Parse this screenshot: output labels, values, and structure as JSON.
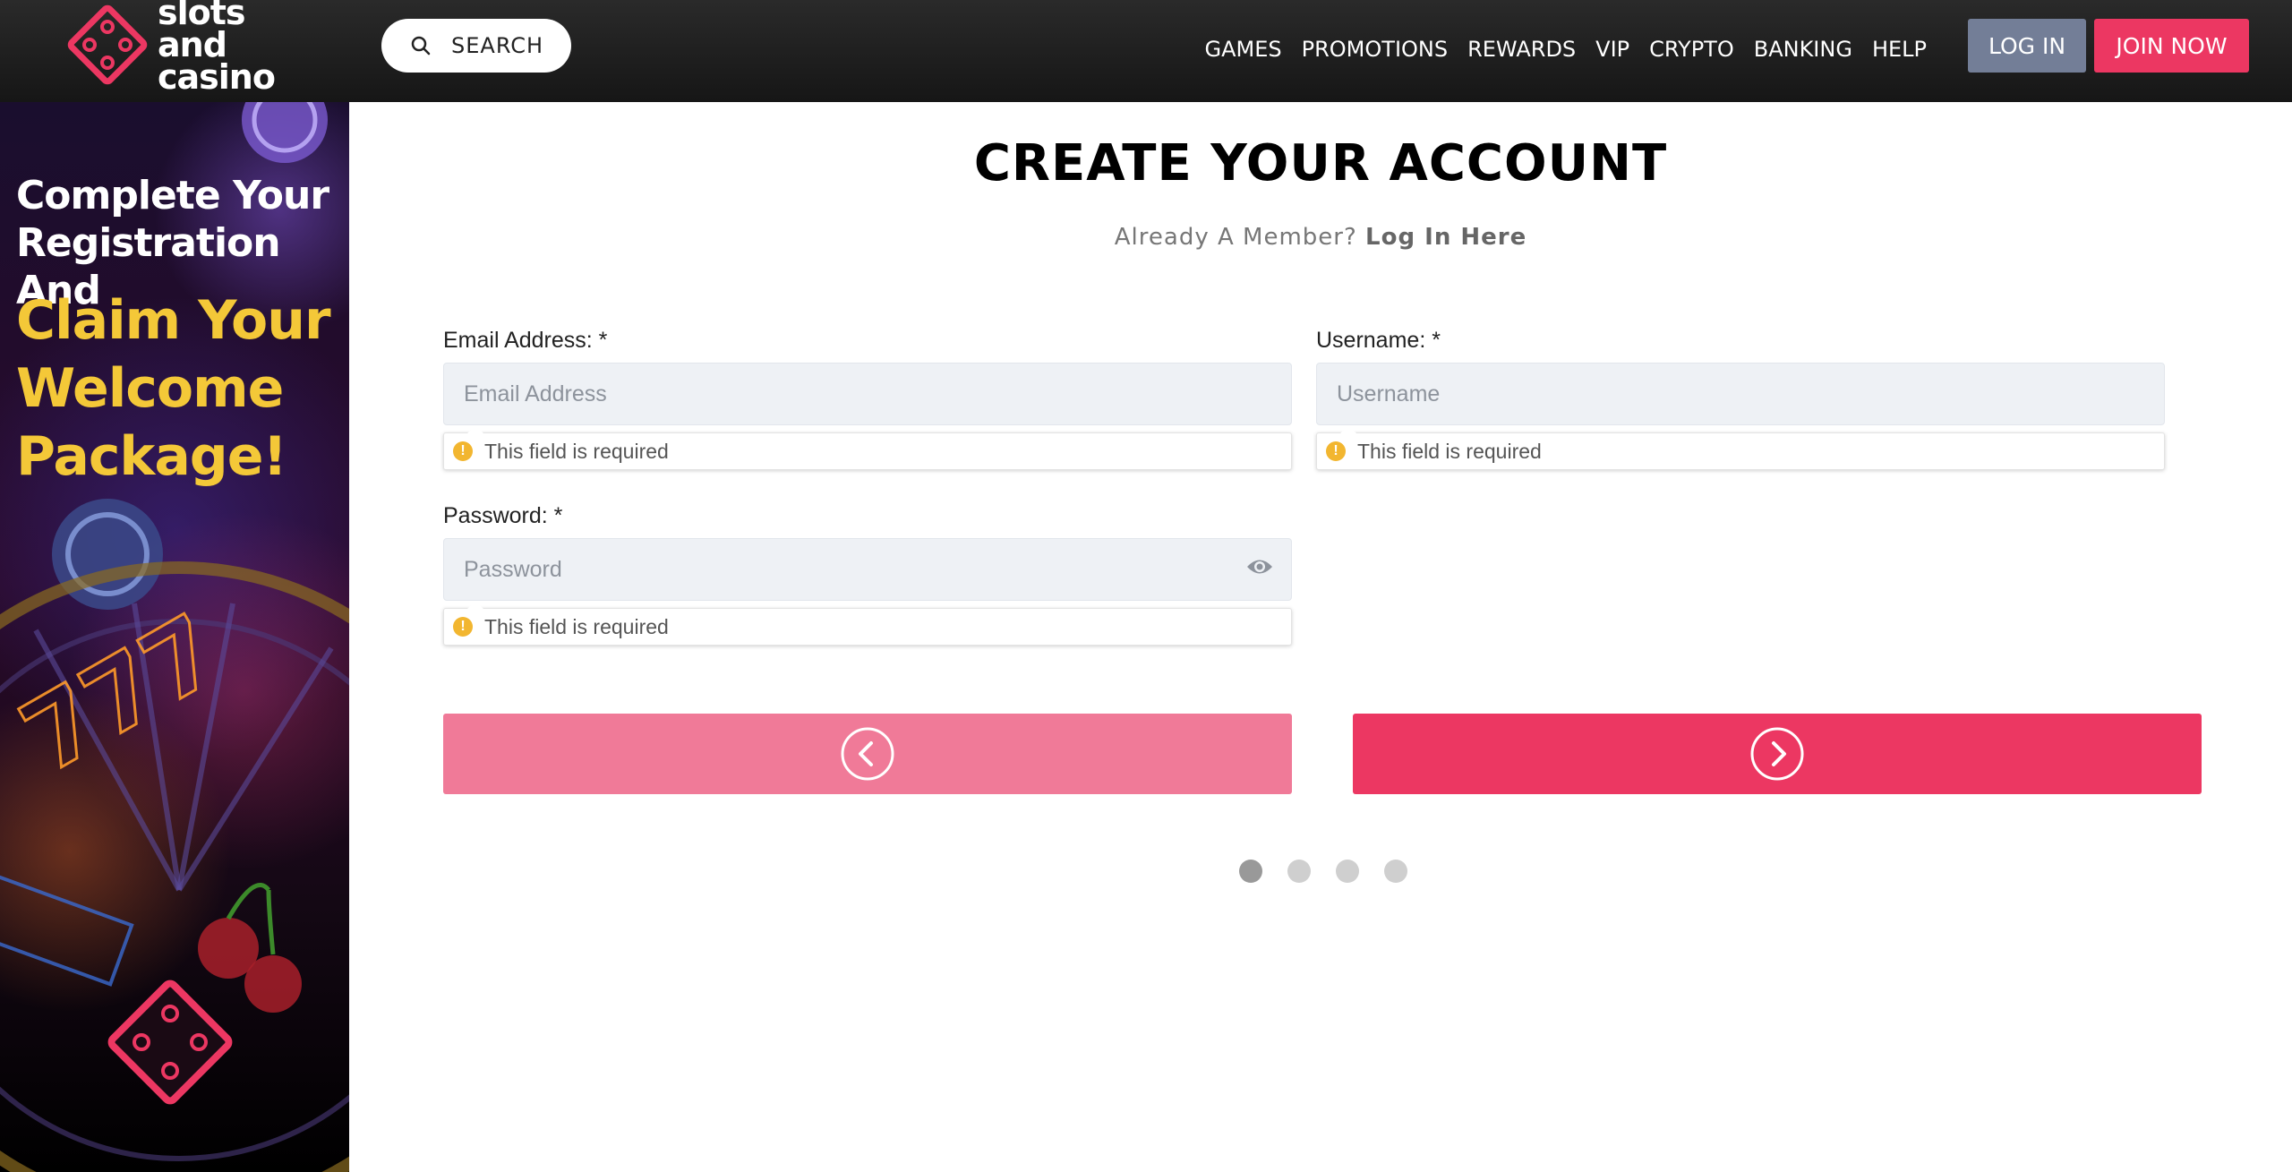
{
  "header": {
    "logo_word1": "slots",
    "logo_word2": "and",
    "logo_word3": "casino",
    "search_label": "SEARCH",
    "nav": [
      "GAMES",
      "PROMOTIONS",
      "REWARDS",
      "VIP",
      "CRYPTO",
      "BANKING",
      "HELP"
    ],
    "login_label": "LOG IN",
    "join_label": "JOIN NOW"
  },
  "promo": {
    "line1": "Complete Your Registration And",
    "line2": "Claim Your Welcome Package!"
  },
  "form": {
    "title": "CREATE YOUR ACCOUNT",
    "member_prompt": "Already A Member?",
    "login_link": "Log In Here",
    "email": {
      "label": "Email Address: *",
      "placeholder": "Email Address",
      "value": "",
      "error": "This field is required"
    },
    "username": {
      "label": "Username: *",
      "placeholder": "Username",
      "value": "",
      "error": "This field is required"
    },
    "password": {
      "label": "Password: *",
      "placeholder": "Password",
      "value": "",
      "error": "This field is required"
    },
    "step_current": 1,
    "step_total": 4
  },
  "colors": {
    "brand_pink": "#ec3762",
    "brand_pink_light": "#f07a98",
    "login_gray": "#737e97",
    "warning": "#f2b630",
    "promo_gold": "#f4c838"
  },
  "icons": {
    "search": "search-icon",
    "eye": "eye-icon",
    "prev": "chevron-left-icon",
    "next": "chevron-right-icon",
    "warning": "warning-icon"
  }
}
